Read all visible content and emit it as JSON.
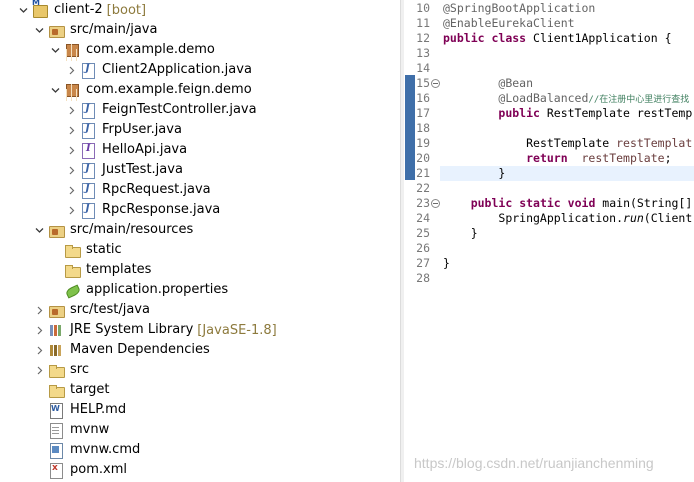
{
  "tree": {
    "items": [
      {
        "label": "client-2",
        "decoration": "[boot]",
        "icon": "project-icon",
        "level": 0,
        "expanded": true
      },
      {
        "label": "src/main/java",
        "icon": "source-folder-icon",
        "level": 1,
        "expanded": true
      },
      {
        "label": "com.example.demo",
        "icon": "package-icon",
        "level": 2,
        "expanded": true
      },
      {
        "label": "Client2Application.java",
        "icon": "java-file-icon",
        "level": 3,
        "expanded": false
      },
      {
        "label": "com.example.feign.demo",
        "icon": "package-icon",
        "level": 2,
        "expanded": true
      },
      {
        "label": "FeignTestController.java",
        "icon": "java-file-icon",
        "level": 3,
        "expanded": false
      },
      {
        "label": "FrpUser.java",
        "icon": "java-file-icon",
        "level": 3,
        "expanded": false
      },
      {
        "label": "HelloApi.java",
        "icon": "java-interface-icon",
        "level": 3,
        "expanded": false
      },
      {
        "label": "JustTest.java",
        "icon": "java-file-icon",
        "level": 3,
        "expanded": false
      },
      {
        "label": "RpcRequest.java",
        "icon": "java-file-icon",
        "level": 3,
        "expanded": false
      },
      {
        "label": "RpcResponse.java",
        "icon": "java-file-icon",
        "level": 3,
        "expanded": false
      },
      {
        "label": "src/main/resources",
        "icon": "source-folder-icon",
        "level": 1,
        "expanded": true
      },
      {
        "label": "static",
        "icon": "folder-icon",
        "level": 2,
        "expanded": null
      },
      {
        "label": "templates",
        "icon": "folder-icon",
        "level": 2,
        "expanded": null
      },
      {
        "label": "application.properties",
        "icon": "properties-file-icon",
        "level": 2,
        "expanded": null
      },
      {
        "label": "src/test/java",
        "icon": "source-folder-icon",
        "level": 1,
        "expanded": false
      },
      {
        "label": "JRE System Library",
        "decoration": "[JavaSE-1.8]",
        "icon": "library-icon",
        "level": 1,
        "expanded": false
      },
      {
        "label": "Maven Dependencies",
        "icon": "maven-library-icon",
        "level": 1,
        "expanded": false
      },
      {
        "label": "src",
        "icon": "folder-icon",
        "level": 1,
        "expanded": false
      },
      {
        "label": "target",
        "icon": "folder-icon",
        "level": 1,
        "expanded": null
      },
      {
        "label": "HELP.md",
        "icon": "markdown-file-icon",
        "level": 1,
        "expanded": null
      },
      {
        "label": "mvnw",
        "icon": "file-icon",
        "level": 1,
        "expanded": null
      },
      {
        "label": "mvnw.cmd",
        "icon": "cmd-file-icon",
        "level": 1,
        "expanded": null
      },
      {
        "label": "pom.xml",
        "icon": "xml-file-icon",
        "level": 1,
        "expanded": null
      }
    ]
  },
  "editor": {
    "line_numbers": [
      "10",
      "11",
      "12",
      "13",
      "14",
      "15",
      "16",
      "17",
      "18",
      "19",
      "20",
      "21",
      "22",
      "23",
      "24",
      "25",
      "26",
      "27",
      "28"
    ],
    "code": {
      "l10": "@SpringBootApplication",
      "l11": "@EnableEurekaClient",
      "l12_kw1": "public",
      "l12_kw2": "class",
      "l12_rest": " Client1Application {",
      "l15": "@Bean",
      "l16_ann": "@LoadBalanced",
      "l16_comment": "//在注册中心里进行查找",
      "l17_kw": "public",
      "l17_rest": " RestTemplate restTemp",
      "l19_type": "RestTemplate ",
      "l19_var": "restTemplat",
      "l20_kw": "return",
      "l20_var": "restTemplate",
      "l20_rest": ";",
      "l21": "}",
      "l23_kw1": "public",
      "l23_kw2": "static",
      "l23_kw3": "void",
      "l23_rest": " main(String[]",
      "l24_cls": "SpringApplication.",
      "l24_method": "run",
      "l24_rest": "(Client",
      "l25": "}",
      "l27": "}"
    },
    "fold_lines": [
      "15",
      "23"
    ],
    "current_line": "21"
  },
  "watermark": "https://blog.csdn.net/ruanjianchenming",
  "colors": {
    "keyword": "#7f0055",
    "annotation": "#646464",
    "comment": "#3f7f5f",
    "field": "#6a3e3e",
    "decoration": "#8d7a3d",
    "markbar": "#3f6fa9"
  }
}
